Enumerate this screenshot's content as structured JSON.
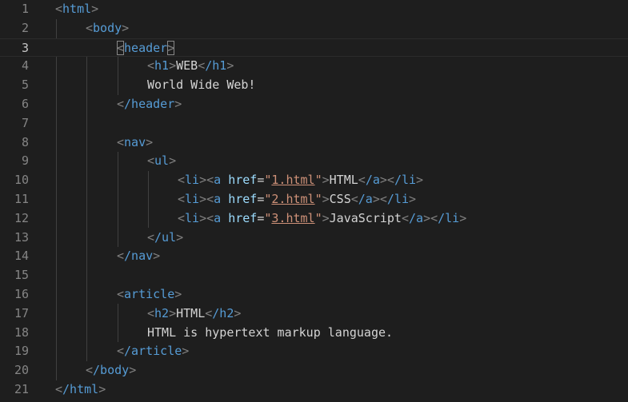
{
  "editor": {
    "line_numbers": [
      "1",
      "2",
      "3",
      "4",
      "5",
      "6",
      "7",
      "8",
      "9",
      "10",
      "11",
      "12",
      "13",
      "14",
      "15",
      "16",
      "17",
      "18",
      "19",
      "20",
      "21"
    ],
    "active_line": "3",
    "colors": {
      "background": "#1e1e1e",
      "tag": "#569cd6",
      "bracket": "#808080",
      "text": "#d4d4d4",
      "attribute": "#9cdcfe",
      "string": "#ce9178"
    }
  },
  "code": {
    "html_open": "html",
    "body_open": "body",
    "header_open": "header",
    "h1_open": "h1",
    "h1_text": "WEB",
    "h1_close": "/h1",
    "header_text": "World Wide Web!",
    "header_close": "/header",
    "nav_open": "nav",
    "ul_open": "ul",
    "li_tag": "li",
    "a_tag": "a",
    "href_attr": "href",
    "eq": "=",
    "quote": "\"",
    "link1_href": "1.html",
    "link1_text": "HTML",
    "link2_href": "2.html",
    "link2_text": "CSS",
    "link3_href": "3.html",
    "link3_text": "JavaScript",
    "a_close": "/a",
    "li_close": "/li",
    "ul_close": "/ul",
    "nav_close": "/nav",
    "article_open": "article",
    "h2_open": "h2",
    "h2_text": "HTML",
    "h2_close": "/h2",
    "article_text": "HTML is hypertext markup language.",
    "article_close": "/article",
    "body_close": "/body",
    "html_close": "/html",
    "lt": "<",
    "gt": ">"
  }
}
